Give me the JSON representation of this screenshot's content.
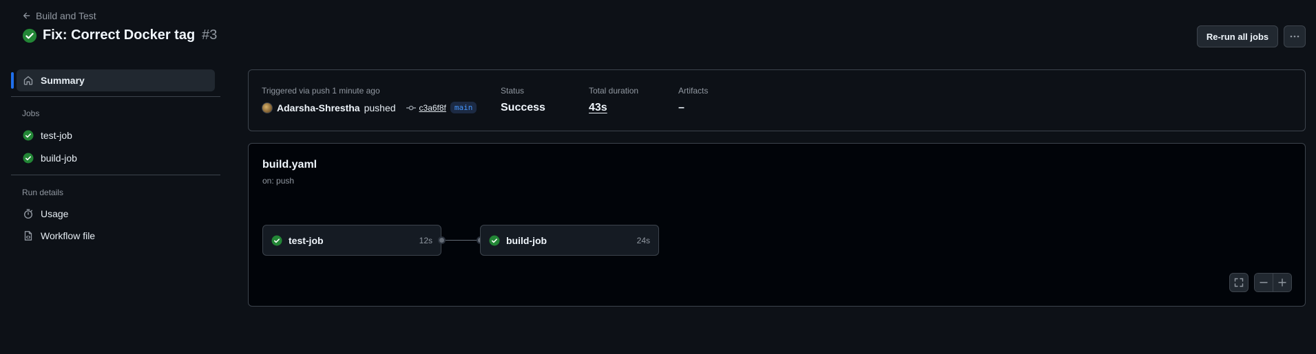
{
  "header": {
    "back_label": "Build and Test",
    "title": "Fix: Correct Docker tag",
    "run_number": "#3",
    "rerun_label": "Re-run all jobs"
  },
  "sidebar": {
    "summary_label": "Summary",
    "jobs_heading": "Jobs",
    "jobs": [
      {
        "label": "test-job",
        "status": "success"
      },
      {
        "label": "build-job",
        "status": "success"
      }
    ],
    "run_details_heading": "Run details",
    "run_details": [
      {
        "label": "Usage",
        "icon": "stopwatch-icon"
      },
      {
        "label": "Workflow file",
        "icon": "file-code-icon"
      }
    ]
  },
  "summary": {
    "trigger_label": "Triggered via push 1 minute ago",
    "author": "Adarsha-Shrestha",
    "action": "pushed",
    "commit": "c3a6f8f",
    "branch": "main",
    "status_label": "Status",
    "status_value": "Success",
    "duration_label": "Total duration",
    "duration_value": "43s",
    "artifacts_label": "Artifacts",
    "artifacts_value": "–"
  },
  "workflow": {
    "file": "build.yaml",
    "trigger": "on: push",
    "jobs": [
      {
        "name": "test-job",
        "duration": "12s"
      },
      {
        "name": "build-job",
        "duration": "24s"
      }
    ]
  },
  "colors": {
    "background": "#0d1117",
    "success": "#238636",
    "accent": "#1f6feb",
    "branch": "#4493f8"
  }
}
